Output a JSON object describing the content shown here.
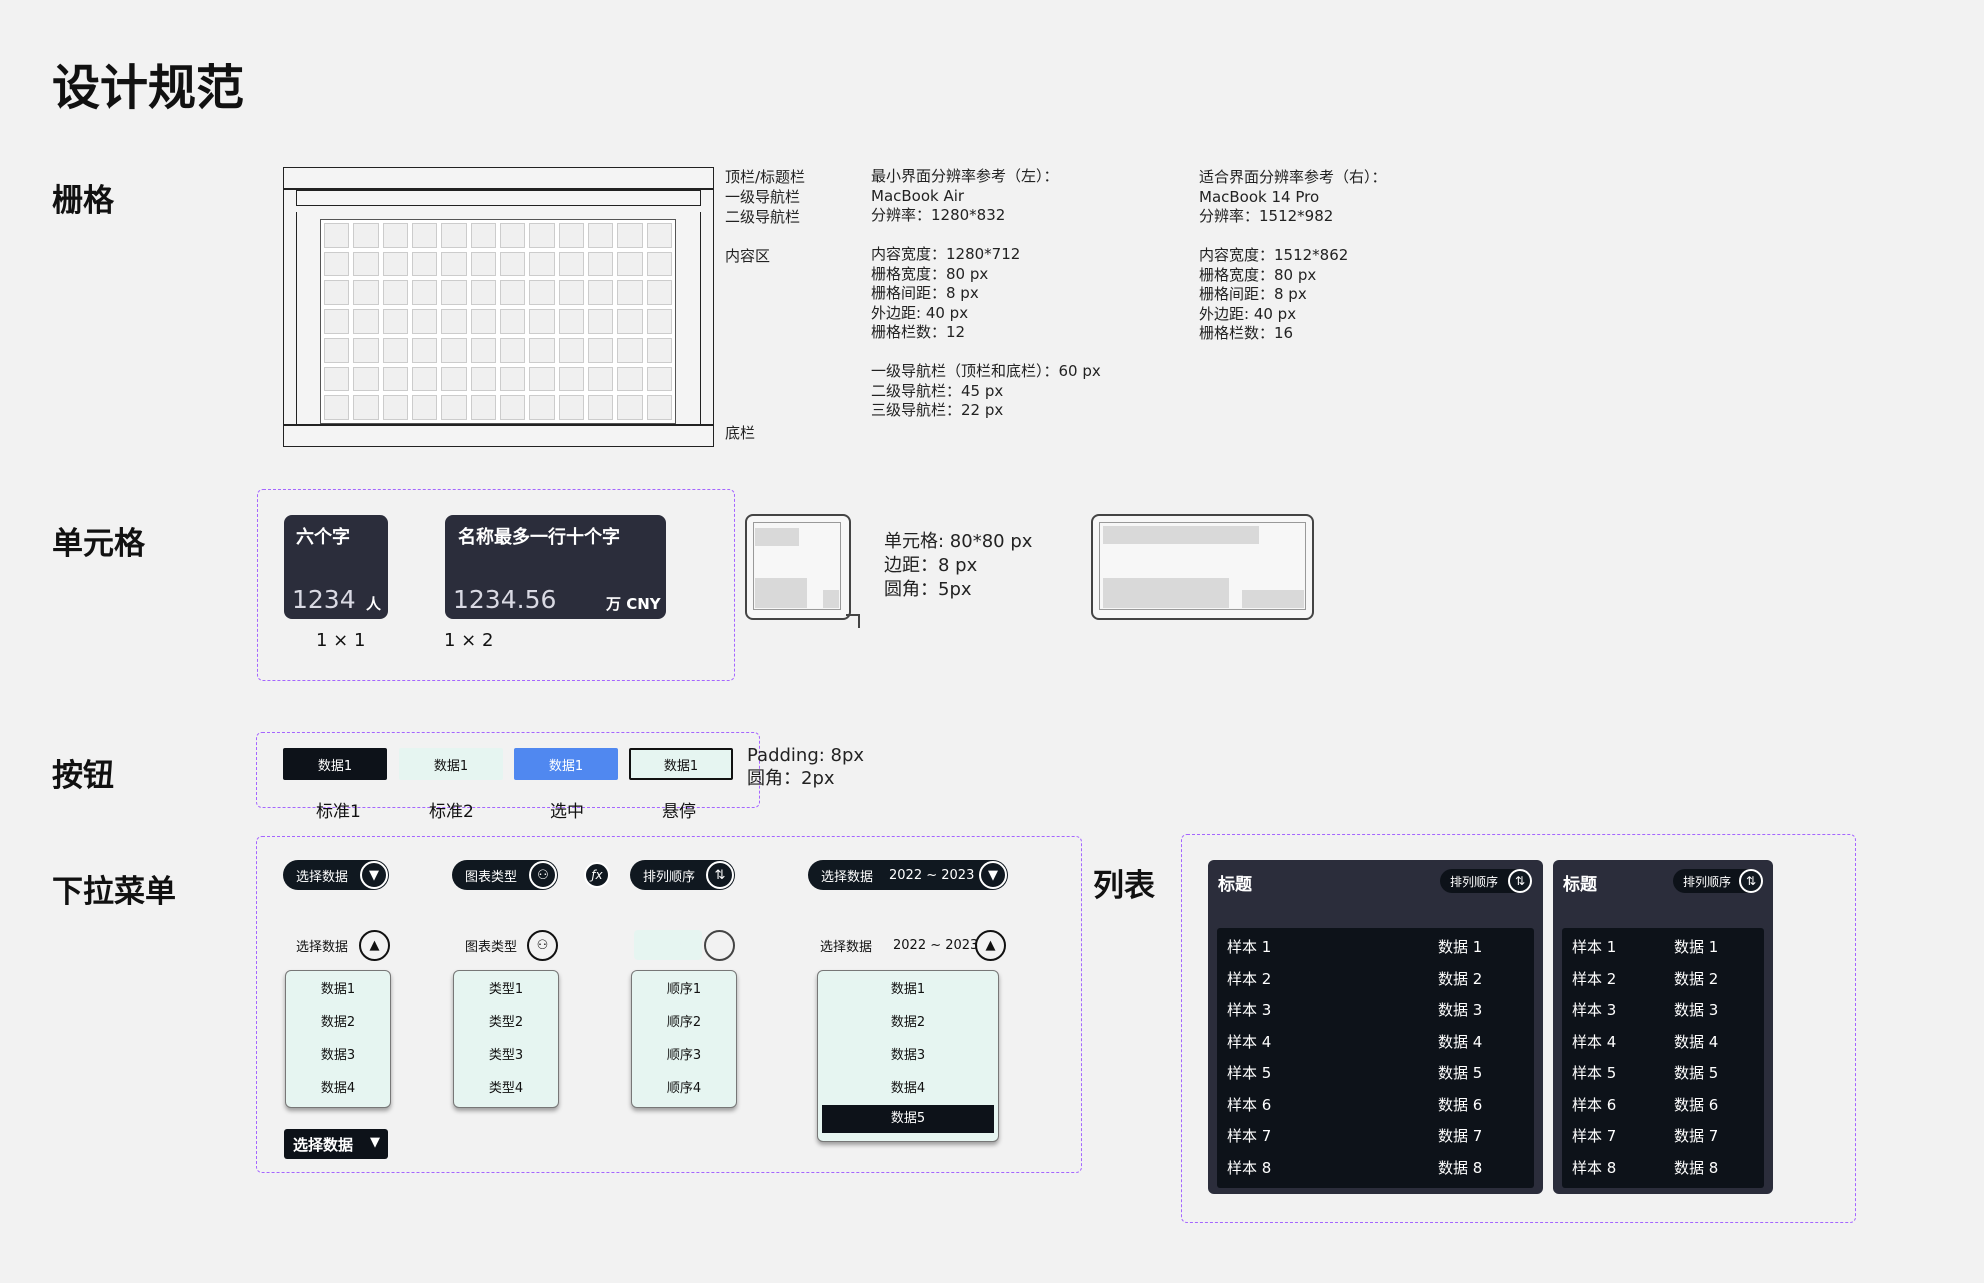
{
  "page_title": "设计规范",
  "sections": {
    "grid": "栅格",
    "cell": "单元格",
    "button": "按钮",
    "dropdown": "下拉菜单",
    "list": "列表"
  },
  "grid": {
    "labels": {
      "topbar": "顶栏/标题栏",
      "nav1": "一级导航栏",
      "nav2": "二级导航栏",
      "content": "内容区",
      "bottom": "底栏"
    },
    "spec_min": "最小界面分辨率参考（左）：\nMacBook Air\n分辨率：1280*832\n\n内容宽度：1280*712\n栅格宽度：80 px\n栅格间距：8 px\n外边距: 40 px\n栅格栏数：12\n\n一级导航栏（顶栏和底栏）：60 px\n二级导航栏：45 px\n三级导航栏：22 px",
    "spec_fit": "适合界面分辨率参考（右）：\nMacBook 14 Pro\n分辨率：1512*982\n\n内容宽度：1512*862\n栅格宽度：80 px\n栅格间距：8 px\n外边距: 40 px\n栅格栏数：16"
  },
  "cell": {
    "card1": {
      "title": "六个字",
      "value": "1234",
      "unit": "人",
      "caption": "1 × 1"
    },
    "card2": {
      "title": "名称最多一行十个字",
      "value": "1234.56",
      "unit": "万 CNY",
      "caption": "1 × 2"
    },
    "spec": "单元格: 80*80 px\n边距：8 px\n圆角：5px"
  },
  "buttons": {
    "items": [
      {
        "label": "数据1",
        "caption": "标准1"
      },
      {
        "label": "数据1",
        "caption": "标准2"
      },
      {
        "label": "数据1",
        "caption": "选中"
      },
      {
        "label": "数据1",
        "caption": "悬停"
      }
    ],
    "spec": "Padding: 8px\n圆角：2px",
    "colors": {
      "dark": "#0d1219",
      "light": "#e6f5f1",
      "selected": "#5088f0"
    }
  },
  "dropdowns": {
    "select_data": "选择数据",
    "chart_type": "图表类型",
    "sort_order": "排列顺序",
    "year_range": "2022 ~ 2023",
    "fx_icon": "fx-icon",
    "menu_data": [
      "数据1",
      "数据2",
      "数据3",
      "数据4"
    ],
    "menu_type": [
      "类型1",
      "类型2",
      "类型3",
      "类型4"
    ],
    "menu_order": [
      "顺序1",
      "顺序2",
      "顺序3",
      "顺序4"
    ],
    "menu_year": [
      "数据1",
      "数据2",
      "数据3",
      "数据4",
      "数据5"
    ],
    "bottom_select": "选择数据"
  },
  "list": {
    "title": "标题",
    "sort": "排列顺序",
    "samples": [
      "样本 1",
      "样本 2",
      "样本 3",
      "样本 4",
      "样本 5",
      "样本 6",
      "样本 7",
      "样本 8"
    ],
    "values": [
      "数据 1",
      "数据 2",
      "数据 3",
      "数据 4",
      "数据 5",
      "数据 6",
      "数据 7",
      "数据 8"
    ]
  },
  "colors": {
    "accent_dashed": "#a566ff",
    "panel": "#2b2d3b",
    "dark": "#0d1219"
  }
}
